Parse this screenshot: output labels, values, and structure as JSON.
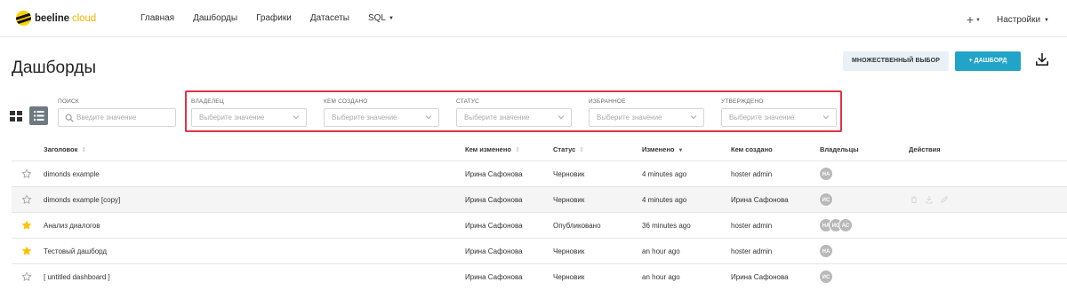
{
  "nav": {
    "logo_main": "beeline",
    "logo_accent": "cloud",
    "links": [
      {
        "label": "Главная"
      },
      {
        "label": "Дашборды"
      },
      {
        "label": "Графики"
      },
      {
        "label": "Датасеты"
      },
      {
        "label": "SQL"
      }
    ],
    "plus": "+",
    "settings": "Настройки"
  },
  "header": {
    "title": "Дашборды",
    "multi_select_label": "МНОЖЕСТВЕННЫЙ ВЫБОР",
    "add_dashboard_label": "+ ДАШБОРД"
  },
  "filters": {
    "search_label": "ПОИСК",
    "search_placeholder": "Введите значение",
    "selects": [
      {
        "label": "ВЛАДЕЛЕЦ",
        "placeholder": "Выберите значение"
      },
      {
        "label": "КЕМ СОЗДАНО",
        "placeholder": "Выберите значение"
      },
      {
        "label": "СТАТУС",
        "placeholder": "Выберите значение"
      },
      {
        "label": "ИЗБРАННОЕ",
        "placeholder": "Выберите значение"
      },
      {
        "label": "УТВЕРЖДЕНО",
        "placeholder": "Выберите значение"
      }
    ]
  },
  "table": {
    "headers": {
      "title": "Заголовок",
      "modified_by": "Кем изменено",
      "status": "Статус",
      "modified": "Изменено",
      "created_by": "Кем создано",
      "owners": "Владельцы",
      "actions": "Действия"
    },
    "rows": [
      {
        "favorite": false,
        "title": "dimonds example",
        "modified_by": "Ирина Сафонова",
        "status": "Черновик",
        "modified": "4 minutes ago",
        "created_by": "hoster admin",
        "owners": [
          "НА"
        ]
      },
      {
        "favorite": false,
        "title": "dimonds example [copy]",
        "modified_by": "Ирина Сафонова",
        "status": "Черновик",
        "modified": "4 minutes ago",
        "created_by": "Ирина Сафонова",
        "owners": [
          "ИС"
        ]
      },
      {
        "favorite": true,
        "title": "Анализ диалогов",
        "modified_by": "Ирина Сафонова",
        "status": "Опубликовано",
        "modified": "36 minutes ago",
        "created_by": "hoster admin",
        "owners": [
          "НА",
          "ИС",
          "АС"
        ]
      },
      {
        "favorite": true,
        "title": "Тестовый дашборд",
        "modified_by": "Ирина Сафонова",
        "status": "Черновик",
        "modified": "an hour ago",
        "created_by": "hoster admin",
        "owners": [
          "НА"
        ]
      },
      {
        "favorite": false,
        "title": "[ untitled dashboard ]",
        "modified_by": "Ирина Сафонова",
        "status": "Черновик",
        "modified": "an hour ago",
        "created_by": "Ирина Сафонова",
        "owners": [
          "ИС"
        ]
      }
    ]
  },
  "colors": {
    "accent": "#22a4c8",
    "highlight_border": "#dc3545",
    "star_active": "#ffc107",
    "brand_yellow": "#ffd200"
  }
}
